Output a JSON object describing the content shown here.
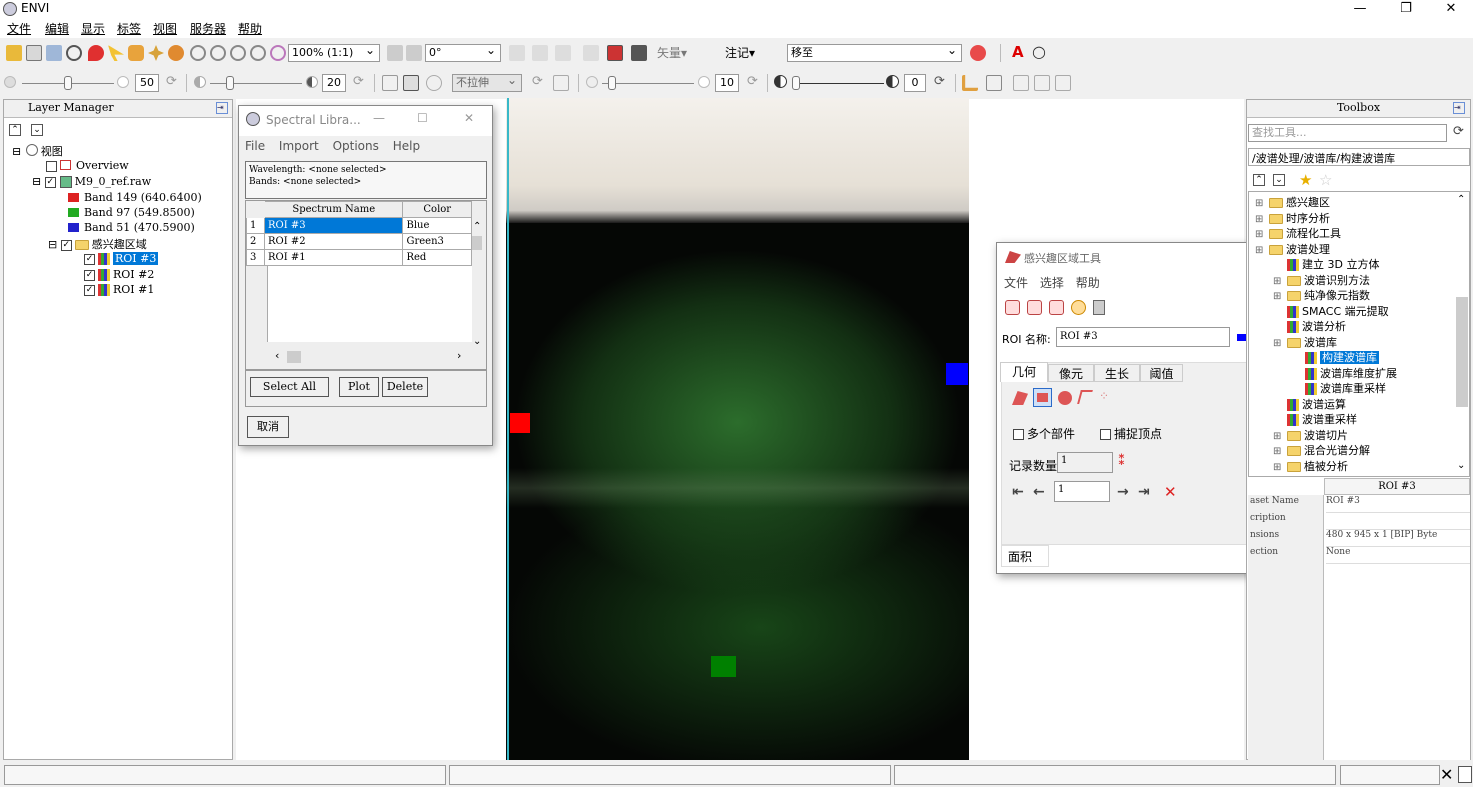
{
  "app": {
    "title": "ENVI"
  },
  "window_controls": {
    "minimize": "—",
    "maximize": "❐",
    "close": "✕"
  },
  "menubar": [
    "文件",
    "编辑",
    "显示",
    "标签",
    "视图",
    "服务器",
    "帮助"
  ],
  "toolbar1": {
    "zoom": "100% (1:1)",
    "rotation": "0°",
    "vector_label": "矢量▾",
    "annotation_label": "注记▾",
    "goto_value": "移至"
  },
  "toolbar2": {
    "brightness": "50",
    "contrast": "20",
    "stretch": "不拉伸",
    "sharpen": "10",
    "transparency": "0"
  },
  "layer_manager": {
    "title": "Layer Manager",
    "root": "视图",
    "overview": "Overview",
    "raster": "M9_0_ref.raw",
    "bands": [
      "Band 149 (640.6400)",
      "Band 97 (549.8500)",
      "Band 51 (470.5900)"
    ],
    "roi_folder": "感兴趣区域",
    "rois": [
      "ROI #3",
      "ROI #2",
      "ROI #1"
    ]
  },
  "spectral_library": {
    "title": "Spectral Libra...",
    "menu": [
      "File",
      "Import",
      "Options",
      "Help"
    ],
    "wavelength": "Wavelength: <none selected>",
    "bands": "Bands: <none selected>",
    "columns": [
      "Spectrum Name",
      "Color"
    ],
    "rows": [
      {
        "num": "1",
        "name": "ROI #3",
        "color": "Blue"
      },
      {
        "num": "2",
        "name": "ROI #2",
        "color": "Green3"
      },
      {
        "num": "3",
        "name": "ROI #1",
        "color": "Red"
      }
    ],
    "select_all": "Select All",
    "plot": "Plot",
    "delete": "Delete",
    "cancel": "取消"
  },
  "roi_tool": {
    "title": "感兴趣区域工具",
    "menu": [
      "文件",
      "选择",
      "帮助"
    ],
    "name_label": "ROI 名称:",
    "name_value": "ROI #3",
    "tabs": [
      "几何",
      "像元",
      "生长",
      "阈值"
    ],
    "multi_part": "多个部件",
    "snap_vertex": "捕捉顶点",
    "record_count_label": "记录数量",
    "record_count": "1",
    "record_index": "1",
    "area_tab": "面积"
  },
  "toolbox": {
    "title": "Toolbox",
    "search_placeholder": "查找工具...",
    "path": "/波谱处理/波谱库/构建波谱库",
    "items": [
      {
        "label": "感兴趣区",
        "indent": 0,
        "icon": "folder"
      },
      {
        "label": "时序分析",
        "indent": 0,
        "icon": "folder"
      },
      {
        "label": "流程化工具",
        "indent": 0,
        "icon": "folder"
      },
      {
        "label": "波谱处理",
        "indent": 0,
        "icon": "folder"
      },
      {
        "label": "建立 3D 立方体",
        "indent": 1,
        "icon": "tool"
      },
      {
        "label": "波谱识别方法",
        "indent": 1,
        "icon": "folder"
      },
      {
        "label": "纯净像元指数",
        "indent": 1,
        "icon": "folder"
      },
      {
        "label": "SMACC 端元提取",
        "indent": 1,
        "icon": "tool"
      },
      {
        "label": "波谱分析",
        "indent": 1,
        "icon": "tool"
      },
      {
        "label": "波谱库",
        "indent": 1,
        "icon": "folder"
      },
      {
        "label": "构建波谱库",
        "indent": 2,
        "icon": "tool",
        "selected": true
      },
      {
        "label": "波谱库维度扩展",
        "indent": 2,
        "icon": "tool"
      },
      {
        "label": "波谱库重采样",
        "indent": 2,
        "icon": "tool"
      },
      {
        "label": "波谱运算",
        "indent": 1,
        "icon": "tool"
      },
      {
        "label": "波谱重采样",
        "indent": 1,
        "icon": "tool"
      },
      {
        "label": "波谱切片",
        "indent": 1,
        "icon": "folder"
      },
      {
        "label": "混合光谱分解",
        "indent": 1,
        "icon": "folder"
      },
      {
        "label": "植被分析",
        "indent": 1,
        "icon": "folder"
      }
    ],
    "props_title": "ROI #3",
    "props": [
      {
        "key": "aset Name",
        "value": "ROI #3"
      },
      {
        "key": "cription",
        "value": ""
      },
      {
        "key": "nsions",
        "value": "480 x 945 x 1 [BIP] Byte"
      },
      {
        "key": "ection",
        "value": "None"
      }
    ]
  },
  "roi_markers": {
    "roi1": "#ff0000",
    "roi2": "#008000",
    "roi3": "#0000ff"
  }
}
